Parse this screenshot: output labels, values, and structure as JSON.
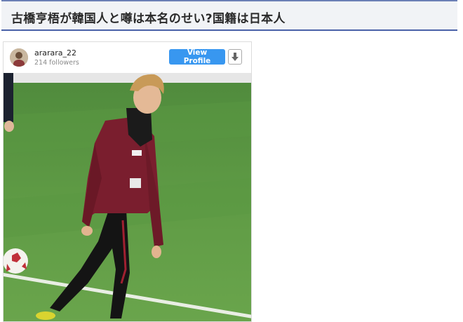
{
  "article": {
    "title": "古橋亨梧が韓国人と噂は本名のせい?国籍は日本人"
  },
  "embed": {
    "username": "ararara_22",
    "followers": "214 followers",
    "view_profile_label": "View Profile",
    "download_icon": "download-arrow-icon",
    "accent_color": "#3897f0"
  }
}
